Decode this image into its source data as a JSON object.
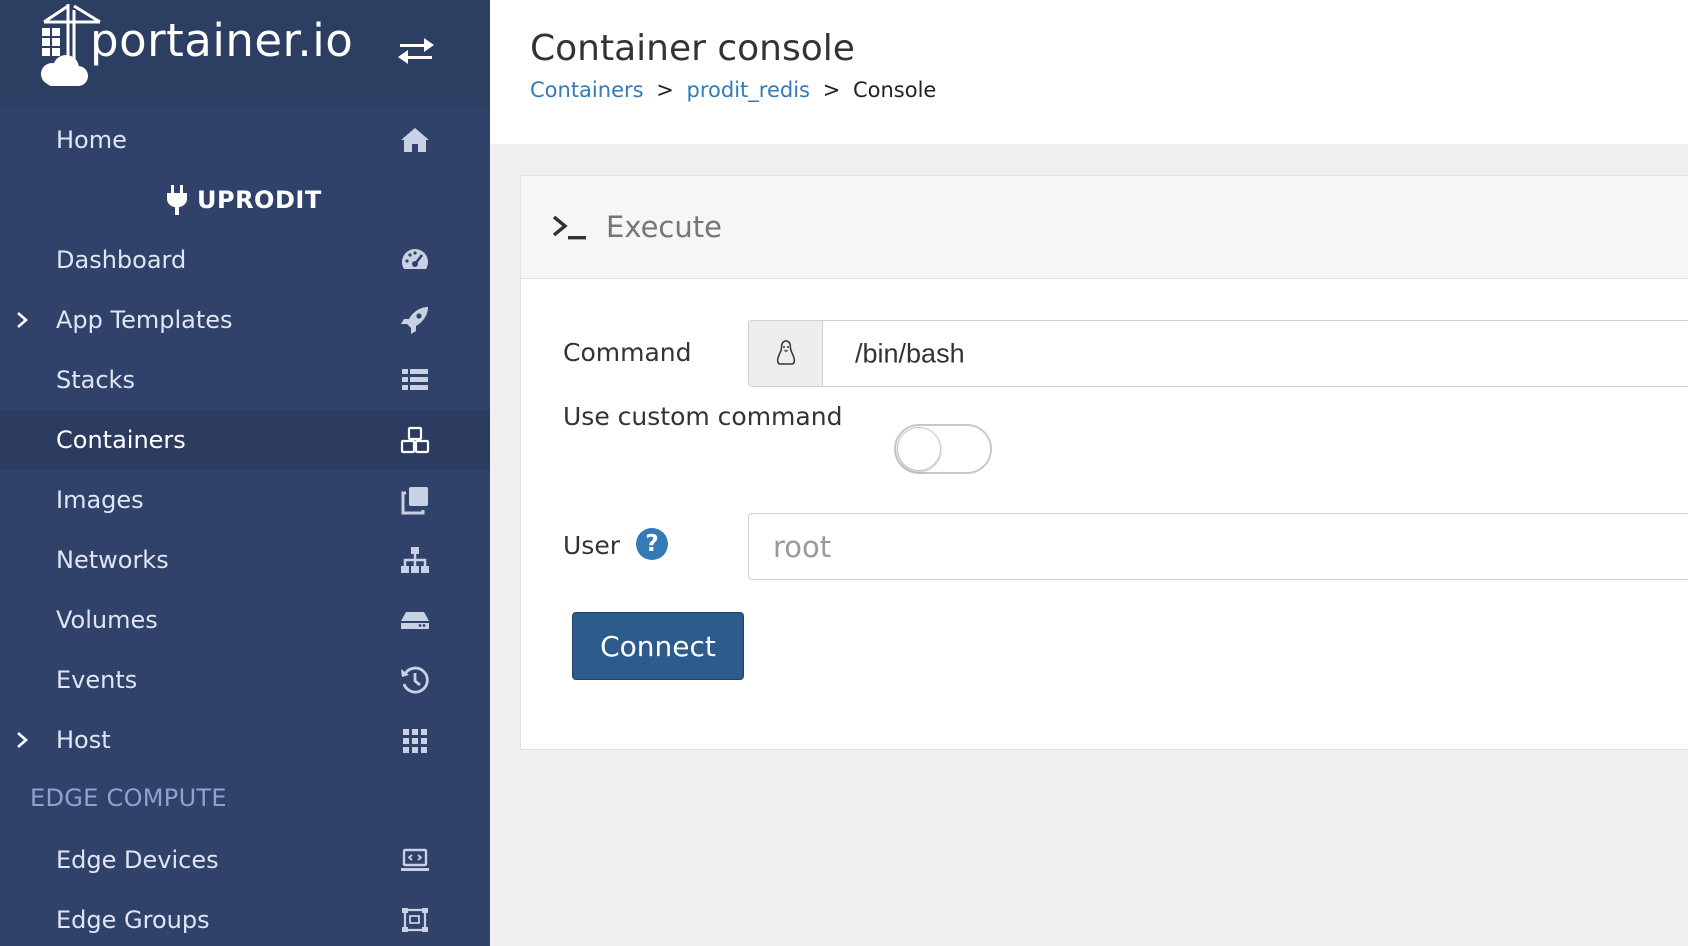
{
  "brand": {
    "logo_text": "portainer.io"
  },
  "sidebar": {
    "home": "Home",
    "endpoint": "UPRODIT",
    "items": [
      {
        "label": "Dashboard",
        "icon": "tachometer-icon"
      },
      {
        "label": "App Templates",
        "icon": "rocket-icon",
        "expandable": true
      },
      {
        "label": "Stacks",
        "icon": "th-list-icon"
      },
      {
        "label": "Containers",
        "icon": "cubes-icon",
        "active": true
      },
      {
        "label": "Images",
        "icon": "clone-icon"
      },
      {
        "label": "Networks",
        "icon": "sitemap-icon"
      },
      {
        "label": "Volumes",
        "icon": "hdd-icon"
      },
      {
        "label": "Events",
        "icon": "history-icon"
      },
      {
        "label": "Host",
        "icon": "th-icon",
        "expandable": true
      }
    ],
    "section_edge": "EDGE COMPUTE",
    "edge_items": [
      {
        "label": "Edge Devices",
        "icon": "laptop-code-icon"
      },
      {
        "label": "Edge Groups",
        "icon": "object-group-icon"
      }
    ]
  },
  "header": {
    "title": "Container console",
    "breadcrumb": {
      "containers": "Containers",
      "container_name": "prodit_redis",
      "current": "Console"
    }
  },
  "execute": {
    "title": "Execute",
    "command_label": "Command",
    "command_value": "/bin/bash",
    "custom_command_label": "Use custom command",
    "custom_command_enabled": false,
    "user_label": "User",
    "user_placeholder": "root",
    "connect_label": "Connect"
  },
  "colors": {
    "sidebar_bg": "#30426a",
    "sidebar_active": "#2b3c60",
    "link": "#337ab7",
    "primary_button": "#2d5c8c",
    "section_heading": "#8fa1d0"
  }
}
